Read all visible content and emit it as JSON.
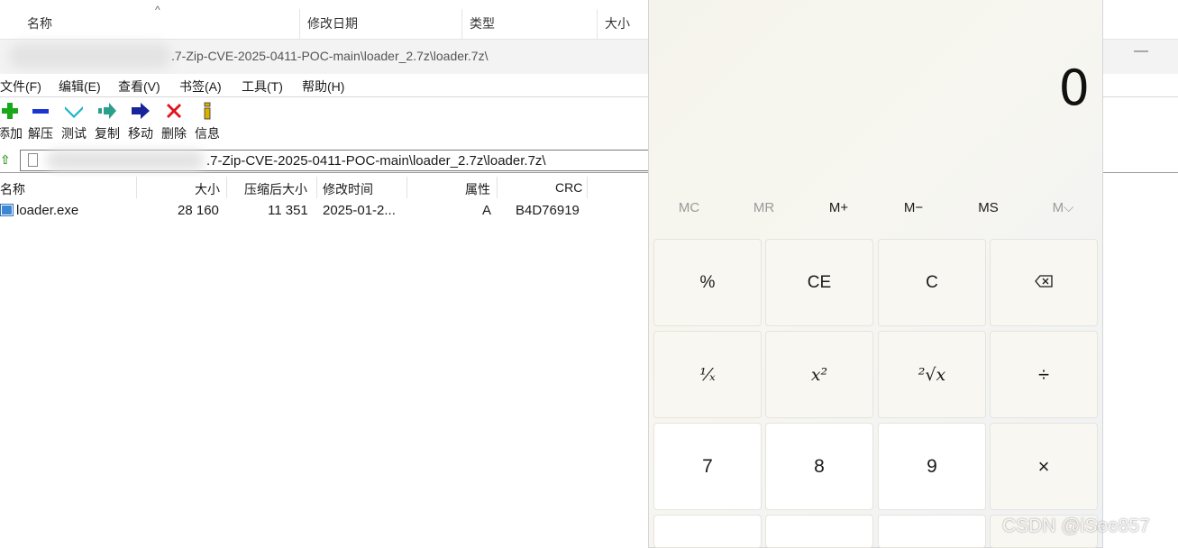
{
  "explorer": {
    "columns": [
      "名称",
      "修改日期",
      "类型",
      "大小"
    ]
  },
  "window": {
    "title_visible": ".7-Zip-CVE-2025-0411-POC-main\\loader_2.7z\\loader.7z\\",
    "minimize": "—"
  },
  "menu": [
    "文件(F)",
    "编辑(E)",
    "查看(V)",
    "书签(A)",
    "工具(T)",
    "帮助(H)"
  ],
  "toolbar": [
    {
      "label": "添加",
      "icon": "add-icon",
      "glyph": "✚",
      "color": "#1aa31a"
    },
    {
      "label": "解压",
      "icon": "extract-icon",
      "glyph": "▬",
      "color": "#1f3fd6"
    },
    {
      "label": "测试",
      "icon": "test-icon",
      "glyph": "✔",
      "color": "#1bb3c9"
    },
    {
      "label": "复制",
      "icon": "copy-icon",
      "glyph": "➡",
      "color": "#2aa38f"
    },
    {
      "label": "移动",
      "icon": "move-icon",
      "glyph": "➡",
      "color": "#1a2a9a"
    },
    {
      "label": "删除",
      "icon": "delete-icon",
      "glyph": "✖",
      "color": "#e0121a"
    },
    {
      "label": "信息",
      "icon": "info-icon",
      "glyph": "ℹ",
      "color": "#c9a400"
    }
  ],
  "address": {
    "path_visible": ".7-Zip-CVE-2025-0411-POC-main\\loader_2.7z\\loader.7z\\"
  },
  "list": {
    "headers": [
      "名称",
      "大小",
      "压缩后大小",
      "修改时间",
      "属性",
      "CRC"
    ],
    "rows": [
      {
        "name": "loader.exe",
        "size": "28 160",
        "packed": "11 351",
        "modified": "2025-01-2...",
        "attr": "A",
        "crc": "B4D76919"
      }
    ]
  },
  "calculator": {
    "display": "0",
    "memory": [
      {
        "label": "MC",
        "enabled": false
      },
      {
        "label": "MR",
        "enabled": false
      },
      {
        "label": "M+",
        "enabled": true
      },
      {
        "label": "M−",
        "enabled": true
      },
      {
        "label": "MS",
        "enabled": true
      },
      {
        "label": "M⌵",
        "enabled": false
      }
    ],
    "keys": {
      "percent": "%",
      "ce": "CE",
      "c": "C",
      "backspace": "⌫",
      "reciprocal": "¹⁄ₓ",
      "square": "x²",
      "sqrt": "²√x",
      "divide": "÷",
      "seven": "7",
      "eight": "8",
      "nine": "9",
      "multiply": "×"
    }
  },
  "watermark": "CSDN @iSee857"
}
